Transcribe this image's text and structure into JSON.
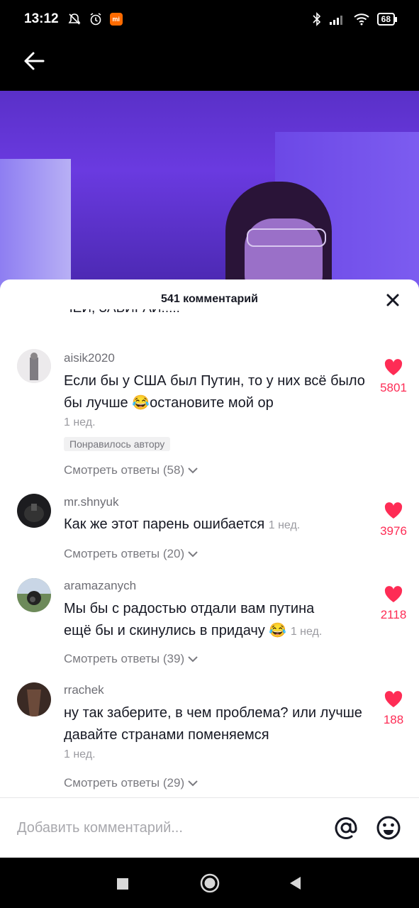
{
  "status_bar": {
    "time": "13:12",
    "battery": "68"
  },
  "sheet": {
    "title": "541 комментарий",
    "clipped_comment_text": "ЧЕЙ, ЗАБИРАЙ!!!!!"
  },
  "comments": [
    {
      "username": "aisik2020",
      "text": "Если бы у США был Путин, то у них всё было бы лучше 😂остановите мой ор",
      "time": "1 нед.",
      "liked_by_author": "Понравилось автору",
      "likes": "5801",
      "replies": "Смотреть ответы (58)"
    },
    {
      "username": "mr.shnyuk",
      "text": "Как же этот парень ошибается",
      "time": "1 нед.",
      "likes": "3976",
      "replies": "Смотреть ответы (20)"
    },
    {
      "username": "aramazanych",
      "text_line1": "Мы бы с радостью отдали вам путина",
      "text_line2": "ещё бы и скинулись в придачу 😂",
      "time": "1 нед.",
      "likes": "2118",
      "replies": "Смотреть ответы (39)"
    },
    {
      "username": "rrachek",
      "text": "ну так заберите, в чем проблема? или лучше давайте странами поменяемся",
      "time": "1 нед.",
      "likes": "188",
      "replies": "Смотреть ответы (29)"
    }
  ],
  "input": {
    "placeholder": "Добавить комментарий..."
  },
  "colors": {
    "like": "#fe2c55",
    "text": "#161823",
    "secondary": "#7a7a80"
  }
}
